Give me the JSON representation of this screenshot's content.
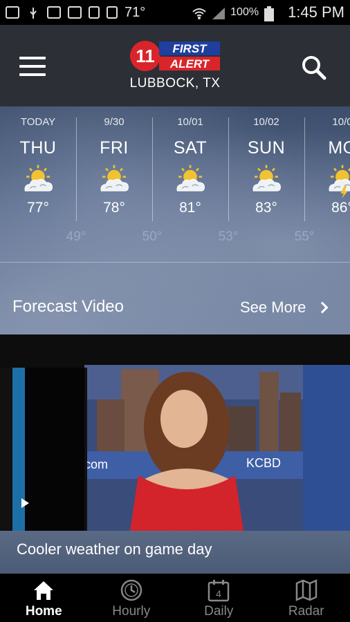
{
  "status_bar": {
    "temperature": "71°",
    "battery": "100%",
    "time": "1:45 PM"
  },
  "header": {
    "logo_text_top": "FIRST",
    "logo_text_bottom": "ALERT",
    "logo_number": "11",
    "location": "LUBBOCK, TX"
  },
  "forecast": {
    "days": [
      {
        "date": "TODAY",
        "dow": "THU",
        "high": "77°",
        "icon": "partly-sunny-icon"
      },
      {
        "date": "9/30",
        "dow": "FRI",
        "high": "78°",
        "icon": "partly-sunny-icon"
      },
      {
        "date": "10/01",
        "dow": "SAT",
        "high": "81°",
        "icon": "partly-sunny-icon"
      },
      {
        "date": "10/02",
        "dow": "SUN",
        "high": "83°",
        "icon": "partly-sunny-icon"
      },
      {
        "date": "10/0",
        "dow": "MO",
        "high": "86°",
        "icon": "thunderstorm-sun-icon"
      }
    ],
    "lows": [
      "49°",
      "50°",
      "53°",
      "55°"
    ]
  },
  "forecast_video": {
    "title": "Forecast Video",
    "see_more": "See More",
    "video_caption": "Cooler weather on game day",
    "video_text_left": "com",
    "video_text_right": "KCBD"
  },
  "bottom_nav": [
    {
      "label": "Home",
      "icon": "home-icon",
      "active": true
    },
    {
      "label": "Hourly",
      "icon": "clock-icon",
      "active": false
    },
    {
      "label": "Daily",
      "icon": "calendar-icon",
      "active": false,
      "badge": "4"
    },
    {
      "label": "Radar",
      "icon": "map-icon",
      "active": false
    }
  ],
  "colors": {
    "header_bg": "#2c2f35",
    "low_temp": "#9aa8c8",
    "logo_red": "#d9252a",
    "logo_blue": "#1f3f9e"
  }
}
